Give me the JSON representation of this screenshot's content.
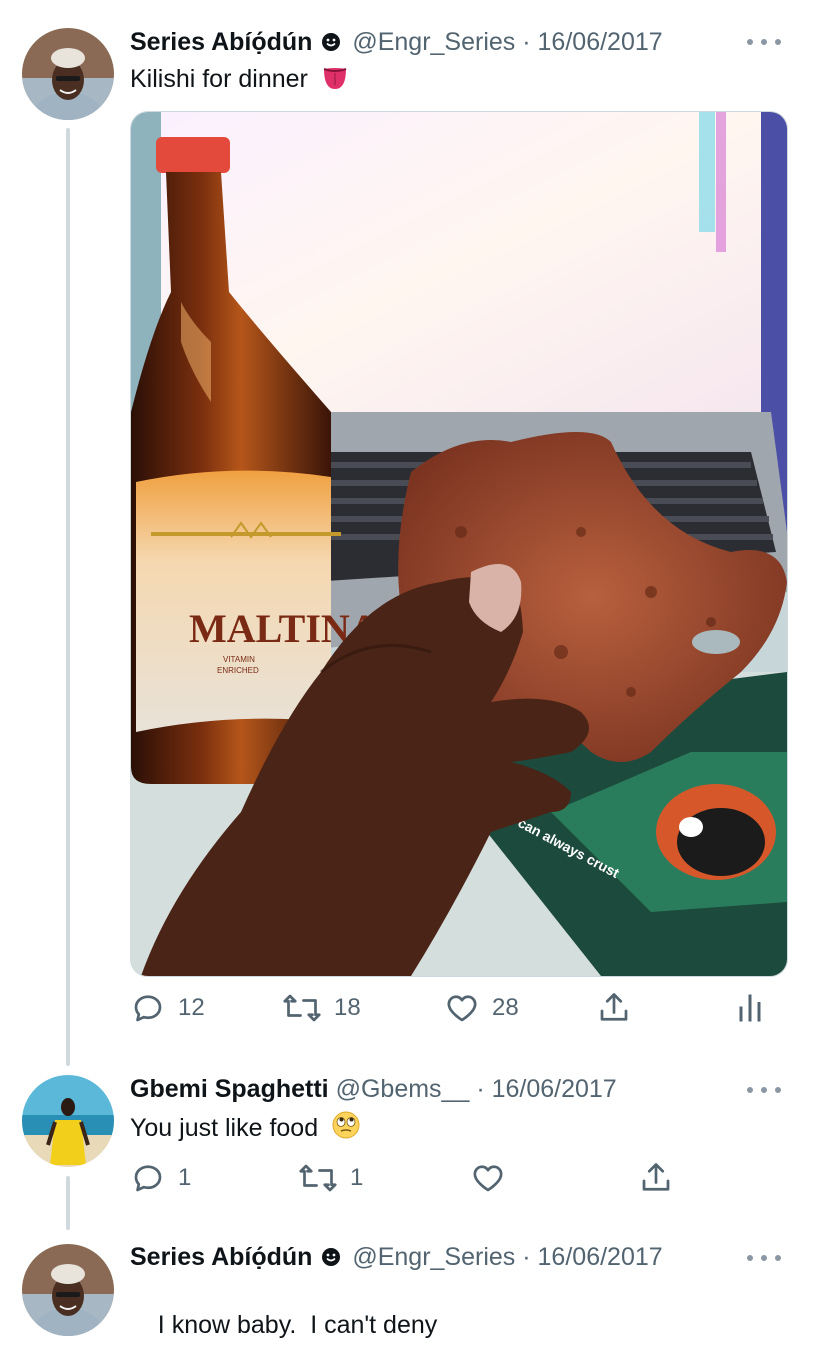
{
  "tweets": [
    {
      "name": "Series Abíọ́dún",
      "handle": "@Engr_Series",
      "separator": "·",
      "date": "16/06/2017",
      "text": "Kilishi for dinner",
      "emoji": "tongue-emoji",
      "media": {
        "bottle_label": "MALTINA",
        "bottle_sublabel_1": "VITAMIN",
        "bottle_sublabel_2": "ENRICHED",
        "packet_text": "You can always crust"
      },
      "stats": {
        "replies": "12",
        "retweets": "18",
        "likes": "28"
      }
    },
    {
      "name": "Gbemi Spaghetti",
      "handle": "@Gbems__",
      "separator": "·",
      "date": "16/06/2017",
      "text": "You just like food",
      "emoji": "eye-roll-emoji",
      "stats": {
        "replies": "1",
        "retweets": "1"
      }
    },
    {
      "name": "Series Abíọ́dún",
      "handle": "@Engr_Series",
      "separator": "·",
      "date": "16/06/2017",
      "text": "I know baby.  I can't deny"
    }
  ],
  "colors": {
    "text": "#0f1419",
    "muted": "#536471",
    "thread_line": "#cfd9de"
  }
}
